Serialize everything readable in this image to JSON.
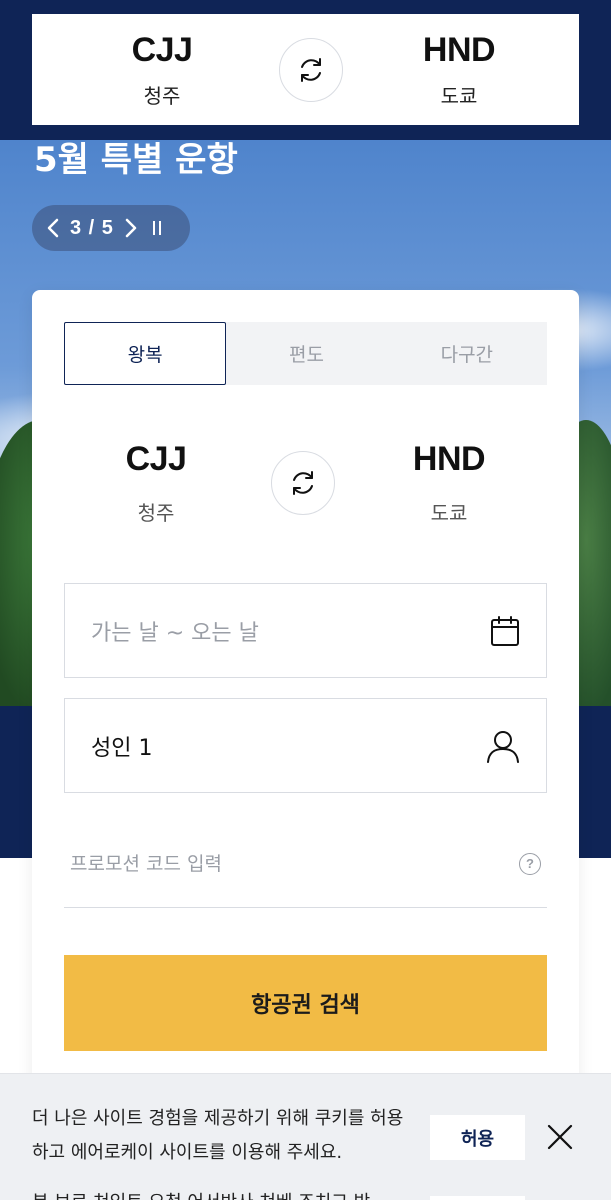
{
  "route_bar": {
    "origin": {
      "code": "CJJ",
      "city": "청주"
    },
    "destination": {
      "code": "HND",
      "city": "도쿄"
    }
  },
  "hero": {
    "title": "5월 특별 운항",
    "pager": "3 / 5"
  },
  "booking": {
    "tabs": [
      {
        "label": "왕복",
        "active": true
      },
      {
        "label": "편도",
        "active": false
      },
      {
        "label": "다구간",
        "active": false
      }
    ],
    "origin": {
      "code": "CJJ",
      "city": "청주"
    },
    "destination": {
      "code": "HND",
      "city": "도쿄"
    },
    "date_placeholder": "가는 날 ~ 오는 날",
    "passengers": "성인 1",
    "promo_placeholder": "프로모션 코드 입력",
    "search_label": "항공권 검색"
  },
  "cookie_banner": {
    "message": "더 나은 사이트 경험을 제공하기 위해 쿠키를 허용하고 에어로케이 사이트를 이용해 주세요.",
    "allow_label": "허용",
    "next_line": "본 브로 쳐있트 요청 어서반사 쳐베 조치교 박"
  },
  "colors": {
    "navy": "#0f2456",
    "accent_yellow": "#f2bb45",
    "border": "#d9dce2"
  },
  "icons": {
    "swap": "swap-icon",
    "calendar": "calendar-icon",
    "person": "person-icon",
    "help": "question-circle-icon",
    "close": "close-icon",
    "prev": "chevron-left-icon",
    "next": "chevron-right-icon",
    "pause": "pause-icon"
  }
}
